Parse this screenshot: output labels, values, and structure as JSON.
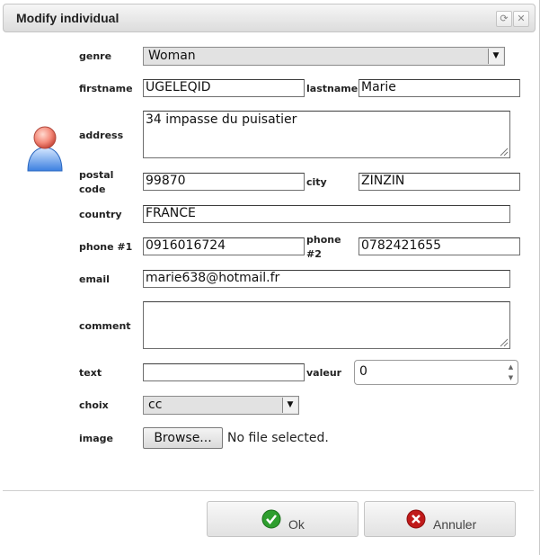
{
  "dialog": {
    "title": "Modify individual",
    "refresh_icon": "refresh-icon",
    "close_icon": "close-icon"
  },
  "avatar": {
    "icon": "user-avatar-icon"
  },
  "form": {
    "genre": {
      "label": "genre",
      "value": "Woman"
    },
    "firstname": {
      "label": "firstname",
      "value": "UGELEQID"
    },
    "lastname": {
      "label": "lastname",
      "value": "Marie"
    },
    "address": {
      "label": "address",
      "value": "34 impasse du puisatier"
    },
    "postal_code": {
      "label_line1": "postal",
      "label_line2": "code",
      "value": "99870"
    },
    "city": {
      "label": "city",
      "value": "ZINZIN"
    },
    "country": {
      "label": "country",
      "value": "FRANCE"
    },
    "phone1": {
      "label": "phone #1",
      "value": "0916016724"
    },
    "phone2": {
      "label_line1": "phone",
      "label_line2": "#2",
      "value": "0782421655"
    },
    "email": {
      "label": "email",
      "value": "marie638@hotmail.fr"
    },
    "comment": {
      "label": "comment",
      "value": ""
    },
    "text": {
      "label": "text",
      "value": ""
    },
    "valeur": {
      "label": "valeur",
      "value": "0"
    },
    "choix": {
      "label": "choix",
      "value": "cc"
    },
    "image": {
      "label": "image",
      "browse_label": "Browse...",
      "status": "No file selected."
    }
  },
  "buttons": {
    "ok": {
      "label": "Ok",
      "icon": "check-icon",
      "color": "#2e9e2e"
    },
    "cancel": {
      "label": "Annuler",
      "icon": "cancel-x-icon",
      "color": "#c01a1a"
    }
  }
}
